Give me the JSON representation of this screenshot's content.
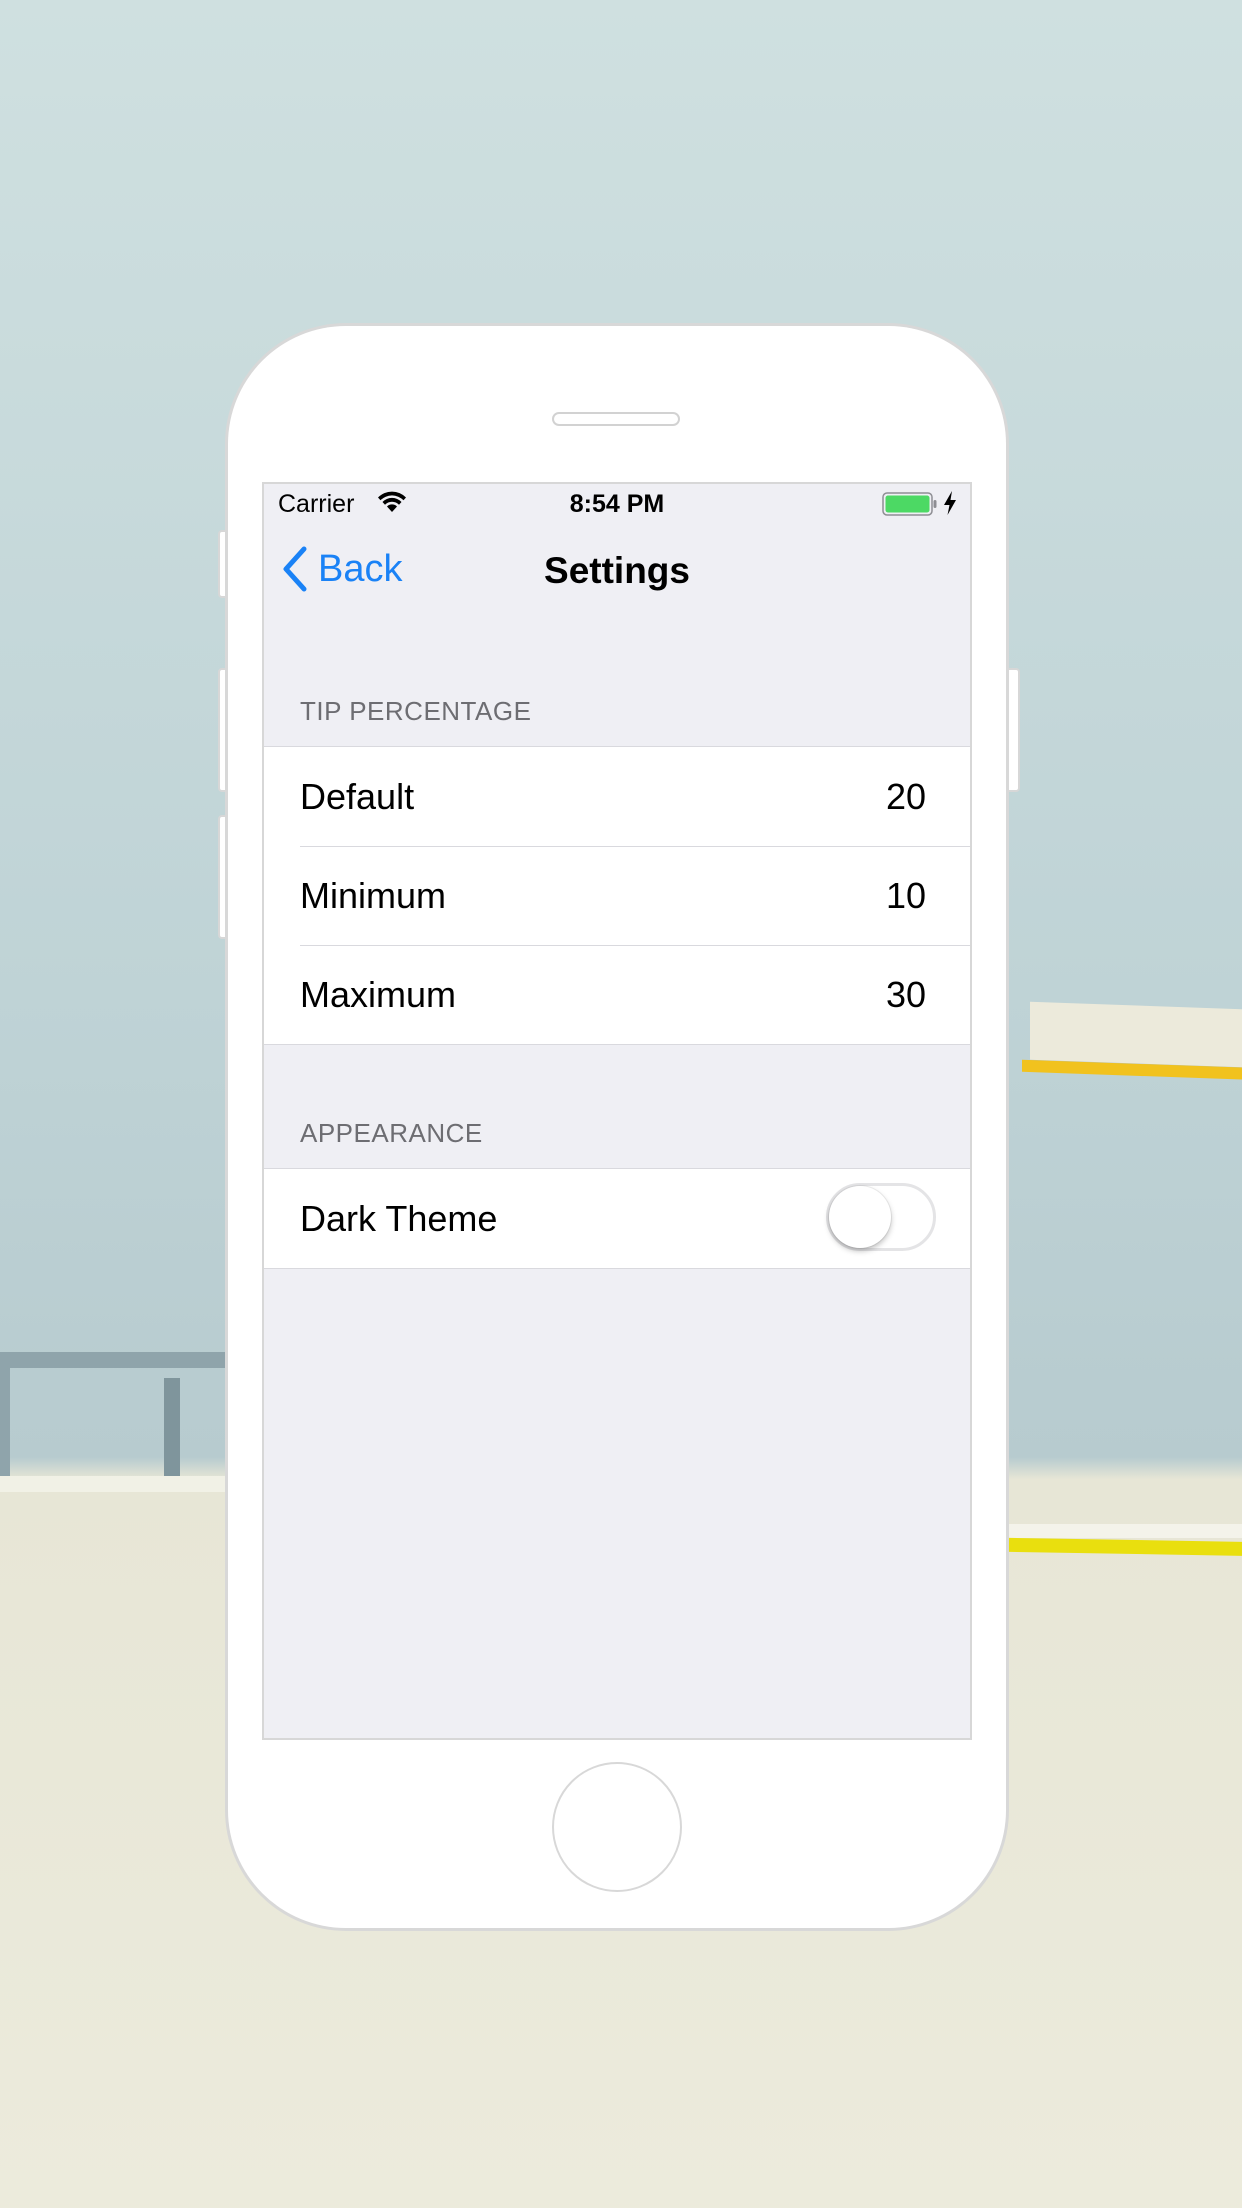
{
  "status_bar": {
    "carrier": "Carrier",
    "time": "8:54 PM"
  },
  "nav": {
    "back_label": "Back",
    "title": "Settings"
  },
  "tip_section": {
    "header": "TIP PERCENTAGE",
    "rows": [
      {
        "label": "Default",
        "value": "20"
      },
      {
        "label": "Minimum",
        "value": "10"
      },
      {
        "label": "Maximum",
        "value": "30"
      }
    ]
  },
  "appearance_section": {
    "header": "APPEARANCE",
    "dark_theme_label": "Dark Theme",
    "dark_theme_on": false
  },
  "colors": {
    "accent": "#1a82f6",
    "battery": "#4cd964",
    "grouped_background": "#efeff4"
  }
}
